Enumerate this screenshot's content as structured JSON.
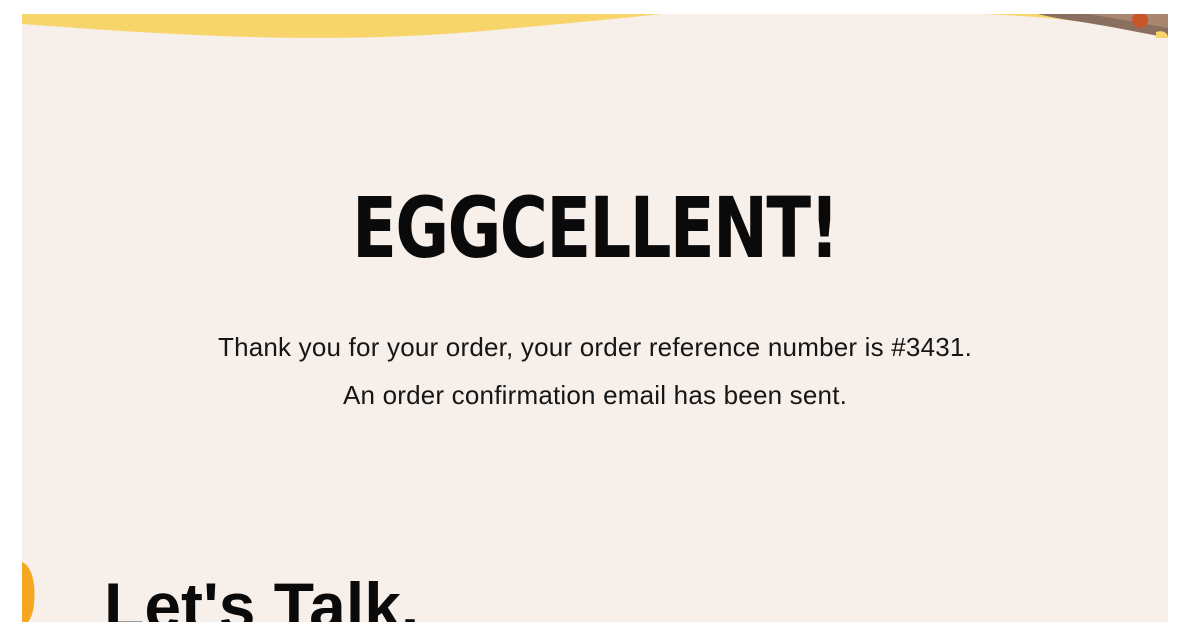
{
  "confirmation": {
    "headline": "EGGCELLENT!",
    "thank_you_line": "Thank you for your order, your order reference number is #3431.",
    "email_line": "An order confirmation email has been sent."
  },
  "contact_section": {
    "title": "Let's Talk."
  },
  "colors": {
    "background": "#f6efea",
    "wave_yellow": "#f8d56b",
    "accent_orange": "#f5a623",
    "text": "#0a0a0a"
  }
}
